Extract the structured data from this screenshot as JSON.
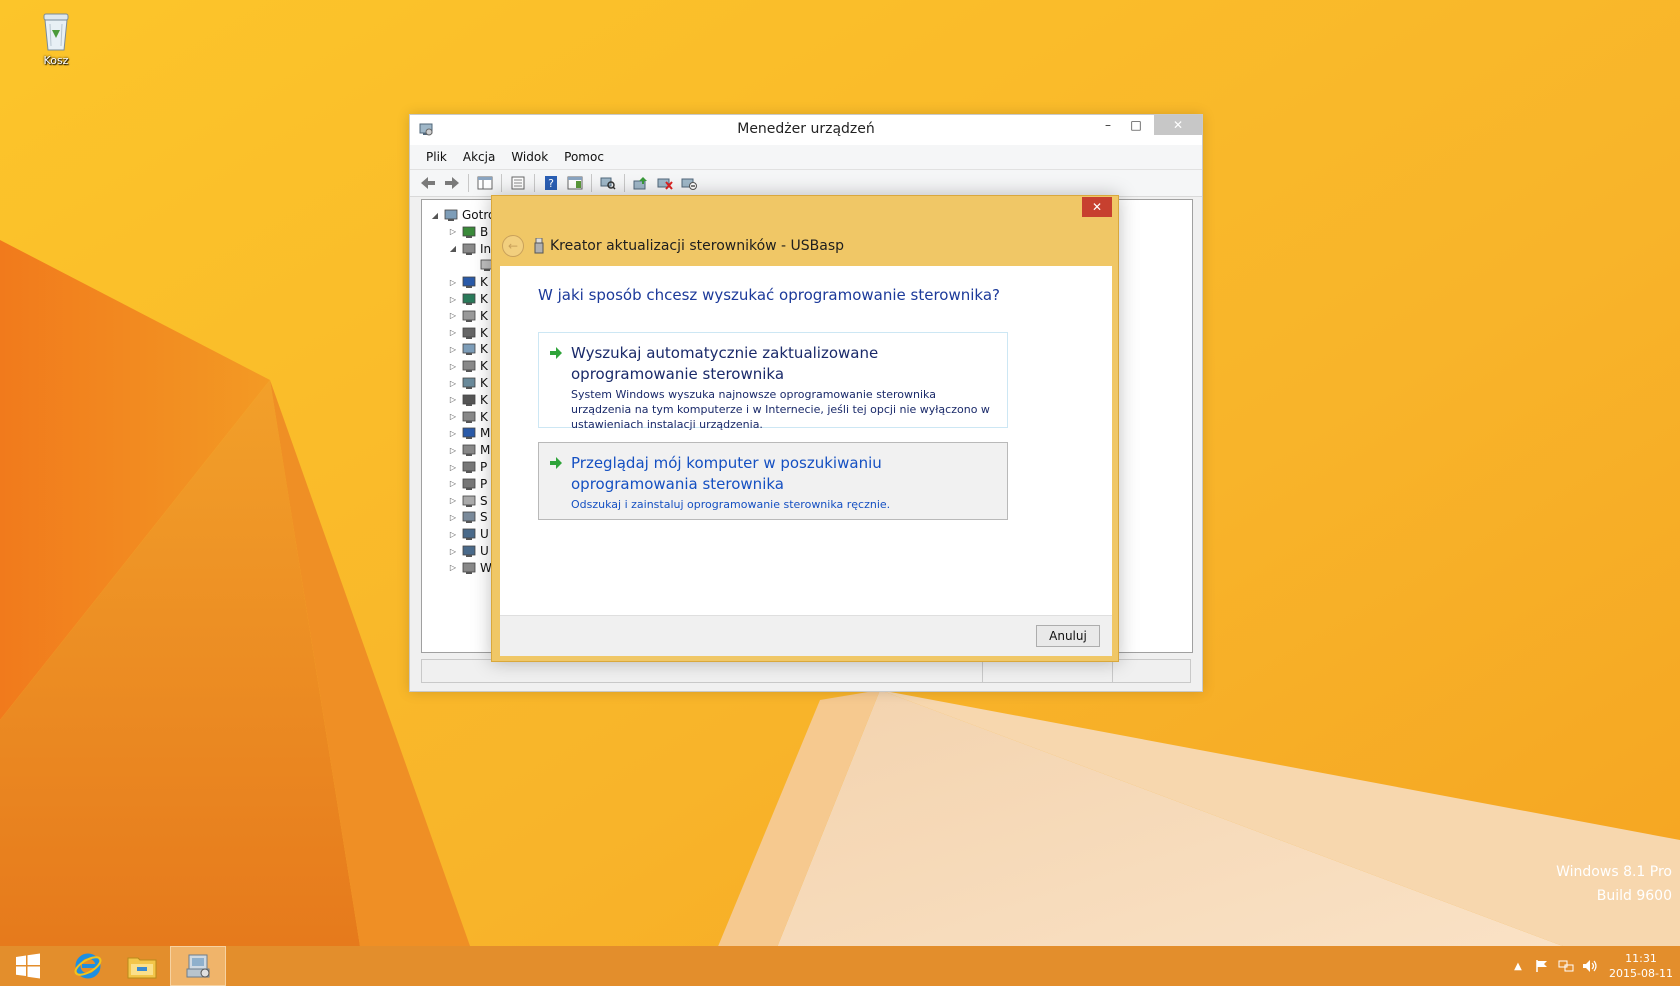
{
  "desktop": {
    "recycle_bin_label": "Kosz",
    "watermark_line1": "Windows 8.1 Pro",
    "watermark_line2": "Build 9600"
  },
  "device_manager": {
    "title": "Menedżer urządzeń",
    "window_controls": {
      "minimize": "–",
      "maximize": "□",
      "close": "✕"
    },
    "menu": [
      "Plik",
      "Akcja",
      "Widok",
      "Pomoc"
    ],
    "toolbar_icons": [
      "back-icon",
      "forward-icon",
      "show-hide-console-tree-icon",
      "properties-sheet-icon",
      "help-icon",
      "action-pane-icon",
      "scan-hardware-icon",
      "update-driver-icon",
      "uninstall-icon",
      "disable-device-icon"
    ],
    "tree": [
      {
        "label": "Gotro",
        "icon": "computer-icon",
        "expander": "◢",
        "level": 0
      },
      {
        "label": "B",
        "icon": "bluetooth-icon",
        "expander": "▷",
        "level": 1
      },
      {
        "label": "In",
        "icon": "other-devices-icon",
        "expander": "◢",
        "level": 1
      },
      {
        "label": "",
        "icon": "usbasp-device-icon",
        "expander": "",
        "level": 2
      },
      {
        "label": "K",
        "icon": "monitor-icon",
        "expander": "▷",
        "level": 1
      },
      {
        "label": "K",
        "icon": "network-icon",
        "expander": "▷",
        "level": 1
      },
      {
        "label": "K",
        "icon": "keyboard-icon",
        "expander": "▷",
        "level": 1
      },
      {
        "label": "K",
        "icon": "printer-icon",
        "expander": "▷",
        "level": 1
      },
      {
        "label": "K",
        "icon": "computer-icon",
        "expander": "▷",
        "level": 1
      },
      {
        "label": "K",
        "icon": "audio-icon",
        "expander": "▷",
        "level": 1
      },
      {
        "label": "K",
        "icon": "storage-icon",
        "expander": "▷",
        "level": 1
      },
      {
        "label": "K",
        "icon": "ports-icon",
        "expander": "▷",
        "level": 1
      },
      {
        "label": "K",
        "icon": "mouse-icon",
        "expander": "▷",
        "level": 1
      },
      {
        "label": "M",
        "icon": "monitor-icon",
        "expander": "▷",
        "level": 1
      },
      {
        "label": "M",
        "icon": "mouse-icon",
        "expander": "▷",
        "level": 1
      },
      {
        "label": "P",
        "icon": "processor-icon",
        "expander": "▷",
        "level": 1
      },
      {
        "label": "P",
        "icon": "processor-icon",
        "expander": "▷",
        "level": 1
      },
      {
        "label": "S",
        "icon": "disk-drive-icon",
        "expander": "▷",
        "level": 1
      },
      {
        "label": "S",
        "icon": "system-devices-icon",
        "expander": "▷",
        "level": 1
      },
      {
        "label": "U",
        "icon": "usb-icon",
        "expander": "▷",
        "level": 1
      },
      {
        "label": "U",
        "icon": "usb-icon",
        "expander": "▷",
        "level": 1
      },
      {
        "label": "W",
        "icon": "audio-icon",
        "expander": "▷",
        "level": 1
      }
    ]
  },
  "wizard": {
    "title": "Kreator aktualizacji sterowników - USBasp",
    "close": "✕",
    "back": "←",
    "question": "W jaki sposób chcesz wyszukać oprogramowanie sterownika?",
    "options": [
      {
        "title": "Wyszukaj automatycznie zaktualizowane oprogramowanie sterownika",
        "description": "System Windows wyszuka najnowsze oprogramowanie sterownika urządzenia na tym komputerze i w Internecie, jeśli tej opcji nie wyłączono w ustawieniach instalacji urządzenia."
      },
      {
        "title": "Przeglądaj mój komputer w poszukiwaniu oprogramowania sterownika",
        "description": "Odszukaj i zainstaluj oprogramowanie sterownika ręcznie."
      }
    ],
    "cancel_label": "Anuluj"
  },
  "taskbar": {
    "items": [
      "start-icon",
      "internet-explorer-icon",
      "file-explorer-icon",
      "device-manager-icon"
    ],
    "tray_icons": [
      "show-hidden-icons-icon",
      "action-center-flag-icon",
      "network-icon",
      "volume-icon"
    ],
    "tray_chevron": "▲",
    "time": "11:31",
    "date": "2015-08-11"
  },
  "colors": {
    "accent_wallpaper": "#f7b52a",
    "wizard_frame": "#f0c766",
    "taskbar": "#e38e2c",
    "link_blue": "#1550c2",
    "question_blue": "#1c3a9a",
    "close_red": "#c7402f"
  }
}
